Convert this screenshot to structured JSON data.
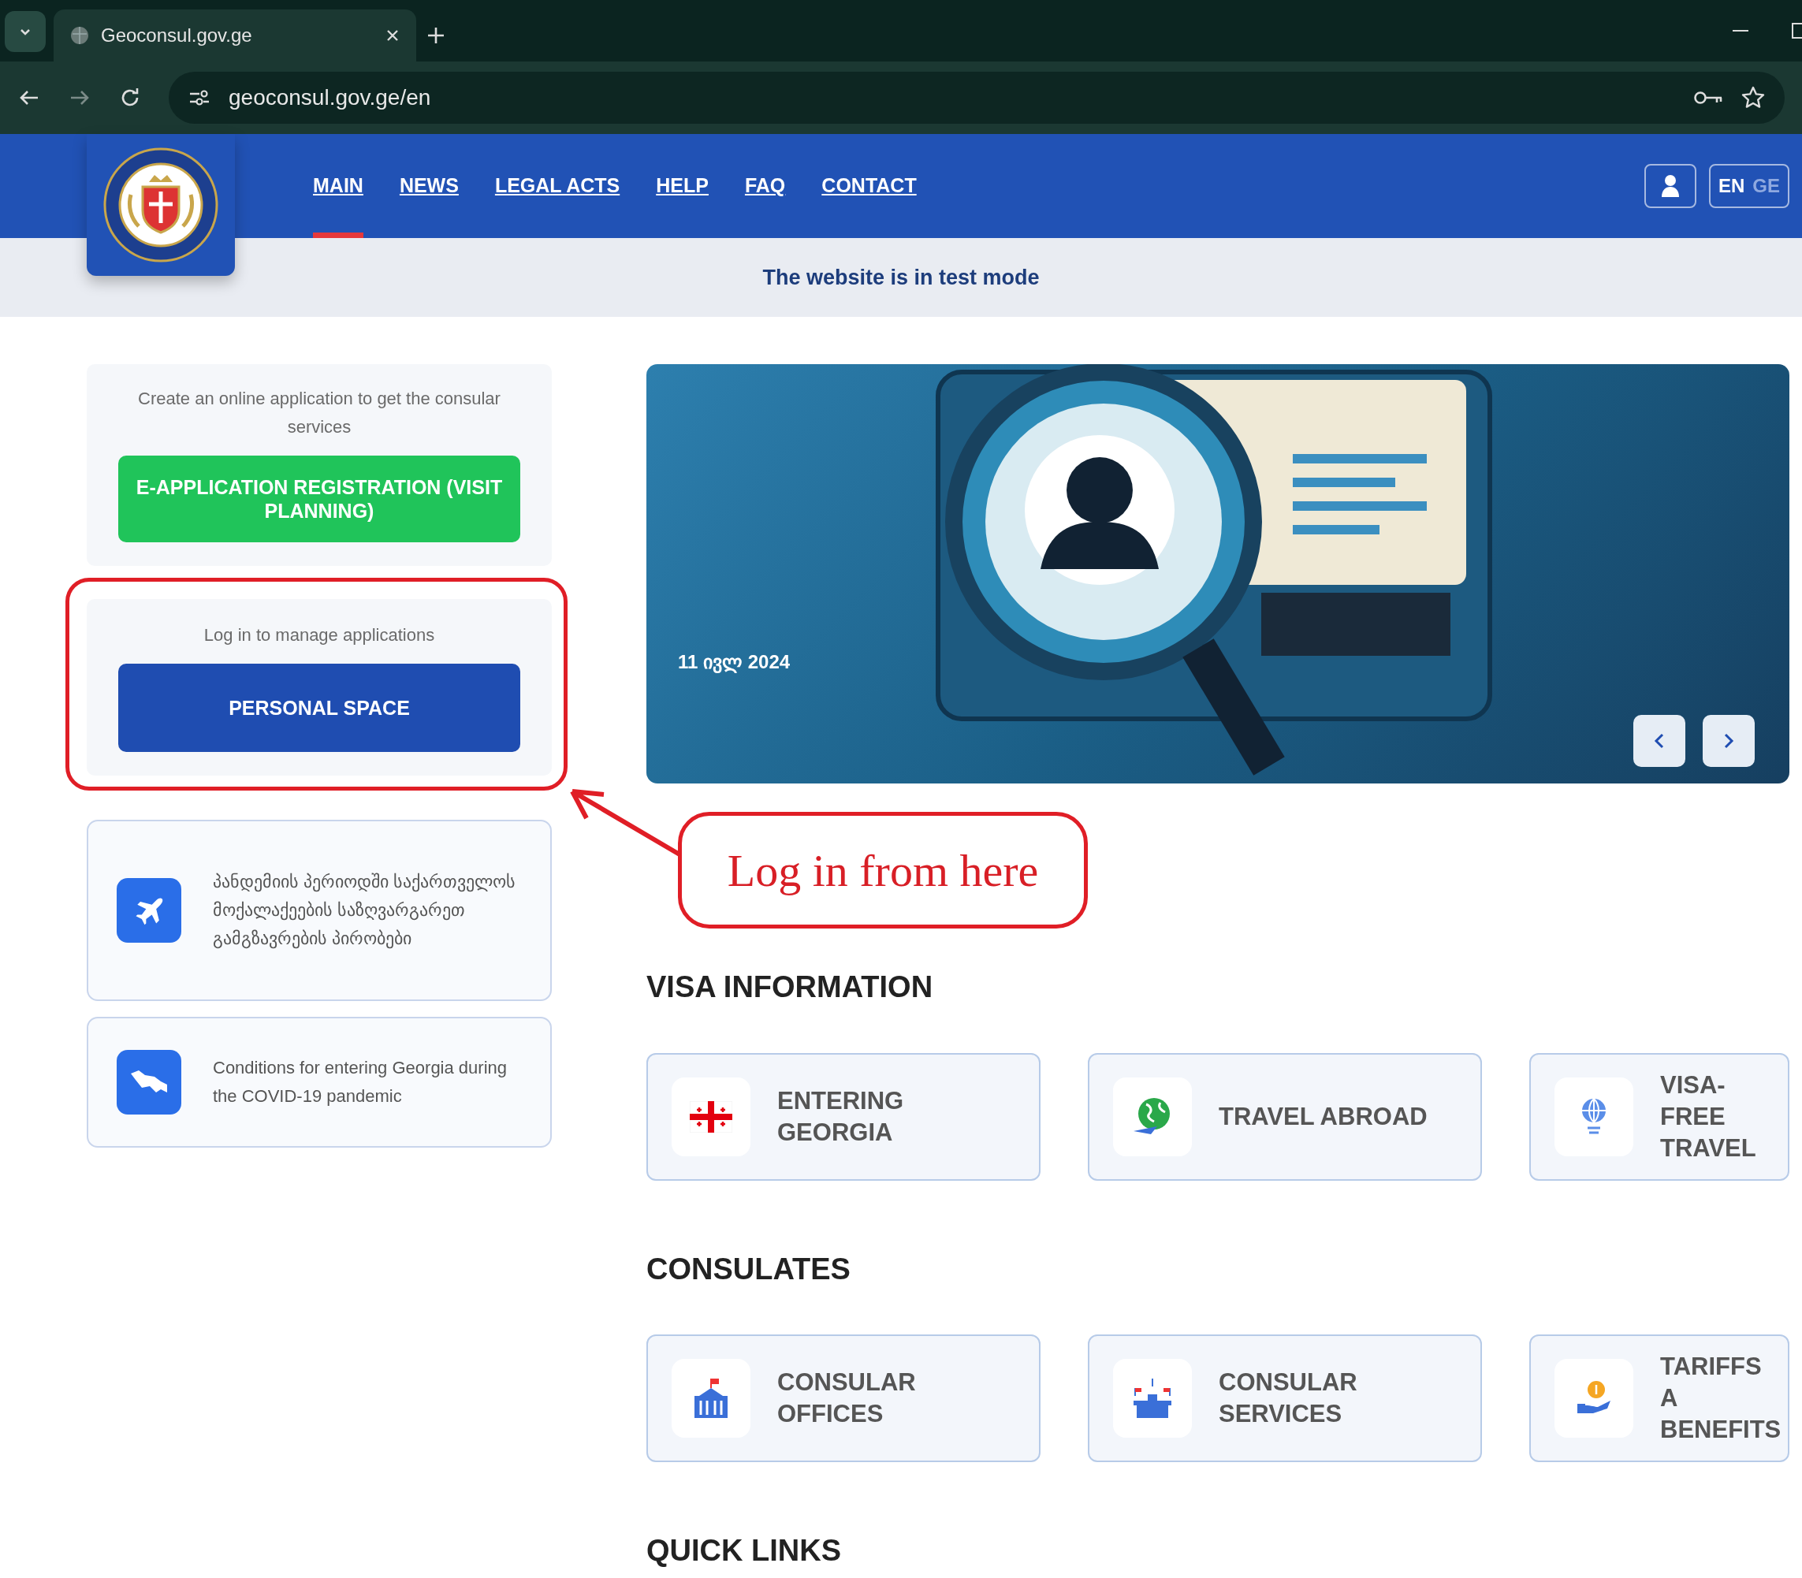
{
  "browser": {
    "tab_title": "Geoconsul.gov.ge",
    "url": "geoconsul.gov.ge/en"
  },
  "nav": {
    "items": [
      {
        "label": "MAIN",
        "selected": true
      },
      {
        "label": "NEWS",
        "selected": false
      },
      {
        "label": "LEGAL ACTS",
        "selected": false
      },
      {
        "label": "HELP",
        "selected": false
      },
      {
        "label": "FAQ",
        "selected": false
      },
      {
        "label": "CONTACT",
        "selected": false
      }
    ],
    "languages": [
      {
        "label": "EN",
        "selected": true
      },
      {
        "label": "GE",
        "selected": false
      }
    ]
  },
  "banner": "The website is in test mode",
  "application_panel": {
    "description": "Create an online application to get the consular services",
    "button": "E-APPLICATION REGISTRATION (VISIT PLANNING)"
  },
  "login_panel": {
    "description": "Log in to manage applications",
    "button": "PERSONAL SPACE"
  },
  "info_cards": [
    {
      "kind": "plane",
      "text": "პანდემიის პერიოდში საქართველოს მოქალაქეების საზღვარგარეთ გამგზავრების პირობები"
    },
    {
      "kind": "map",
      "text": "Conditions for entering Georgia during the COVID-19 pandemic"
    }
  ],
  "slider": {
    "date": "11 ივლ 2024"
  },
  "annotation": {
    "text": "Log in from here"
  },
  "sections": [
    {
      "title": "VISA INFORMATION",
      "cards": [
        {
          "kind": "flag",
          "label": "ENTERING GEORGIA"
        },
        {
          "kind": "globe",
          "label": "TRAVEL ABROAD"
        },
        {
          "kind": "bulb",
          "label": "VISA-FREE TRAVEL"
        }
      ]
    },
    {
      "title": "CONSULATES",
      "cards": [
        {
          "kind": "building",
          "label": "CONSULAR OFFICES"
        },
        {
          "kind": "desk",
          "label": "CONSULAR SERVICES"
        },
        {
          "kind": "coin",
          "label": "TARIFFS A BENEFITS"
        }
      ]
    },
    {
      "title": "QUICK LINKS"
    }
  ]
}
